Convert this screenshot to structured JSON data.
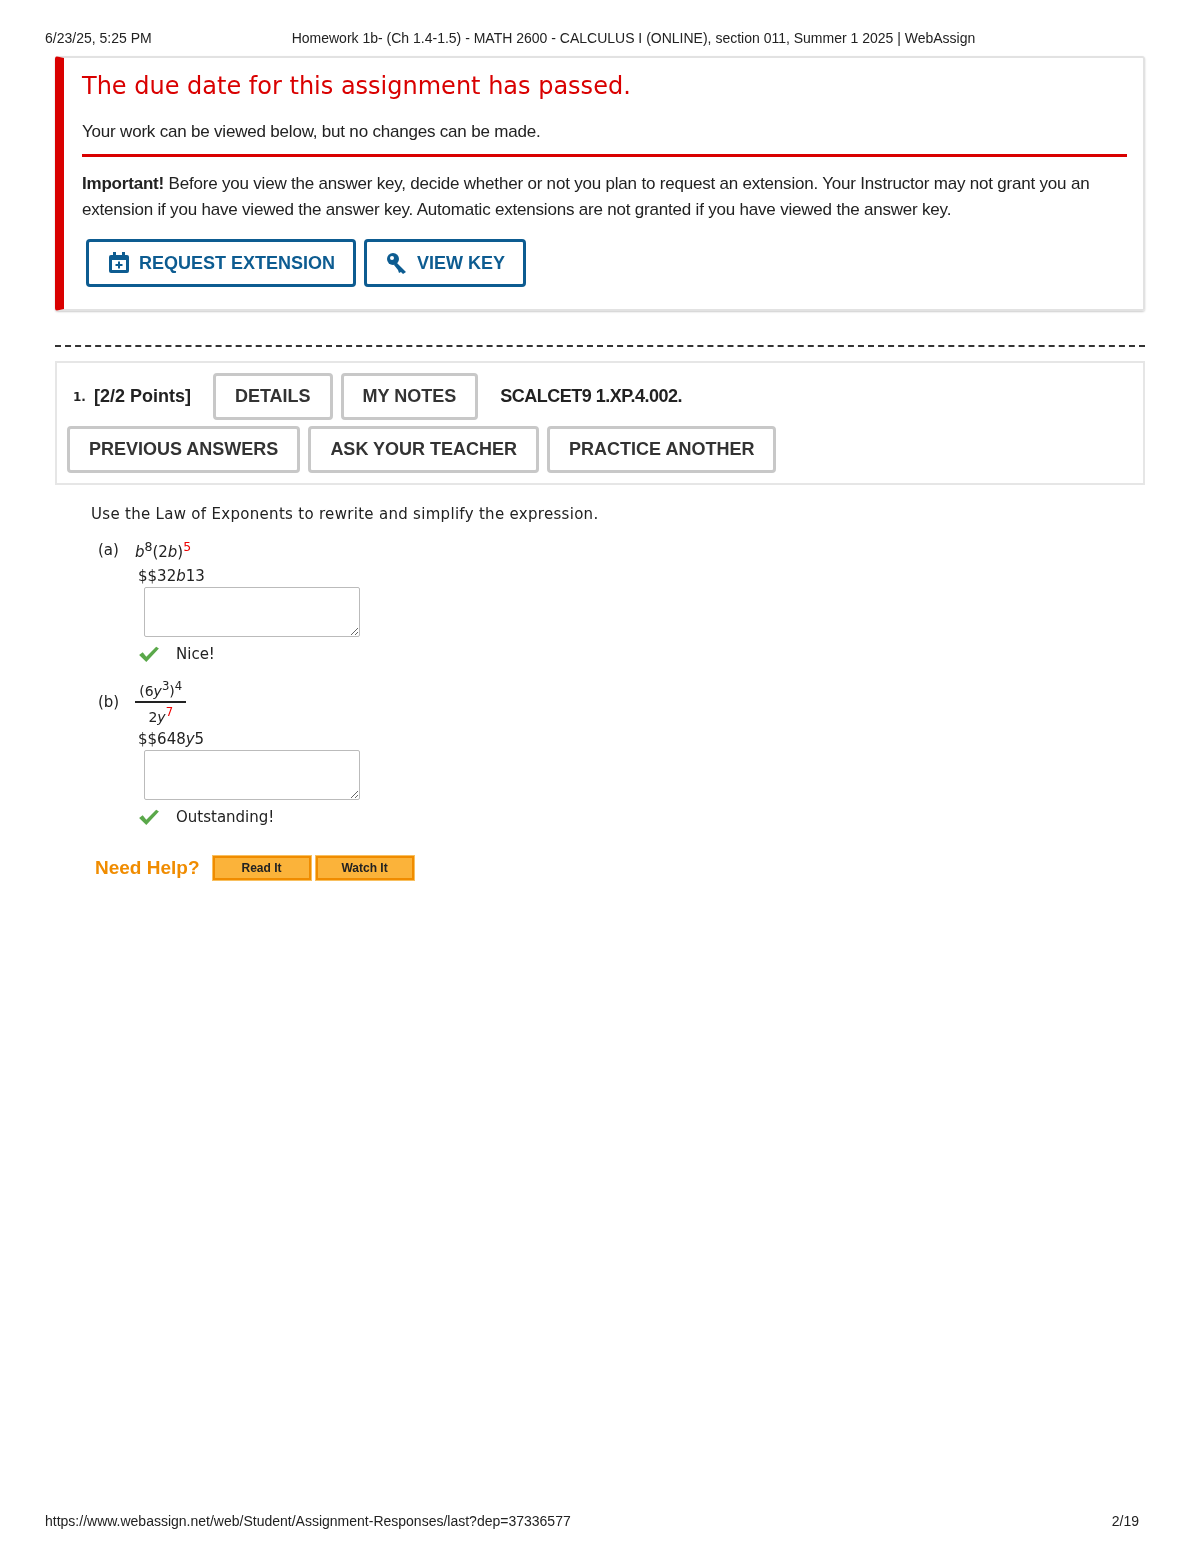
{
  "print_header": {
    "date": "6/23/25, 5:25 PM",
    "title": "Homework 1b- (Ch 1.4-1.5) - MATH 2600 - CALCULUS I (ONLINE), section 011, Summer 1 2025 | WebAssign"
  },
  "notice": {
    "heading": "The due date for this assignment has passed.",
    "message": "Your work can be viewed below, but no changes can be made.",
    "important": "**Important!** Before you view the answer key, decide whether or not you plan to request an extension. Your Instructor may not grant you an extension if you have viewed the answer key. Automatic extensions are not granted if you have viewed the answer key.",
    "buttons": [
      {
        "kind": "calendar",
        "label": "REQUEST EXTENSION"
      },
      {
        "kind": "key",
        "label": "VIEW KEY"
      }
    ]
  },
  "question": {
    "number": "1.",
    "points": "[2/2 Points]",
    "top_buttons": [
      "DETAILS",
      "MY NOTES"
    ],
    "code": "SCALCET9 1.XP.4.002.",
    "buttons": [
      "PREVIOUS ANSWERS",
      "ASK YOUR TEACHER",
      "PRACTICE ANOTHER"
    ],
    "prompt": "Use the Law of Exponents to rewrite and simplify the expression.",
    "parts": [
      {
        "kind": "inline",
        "label": "(a)",
        "expression": [
          {
            "kind": "var",
            "text": "b"
          },
          {
            "kind": "sup",
            "text": "8"
          },
          {
            "kind": "plain",
            "text": "(2"
          },
          {
            "kind": "var",
            "text": "b"
          },
          {
            "kind": "plain",
            "text": ")"
          },
          {
            "kind": "sup_red",
            "text": "5"
          }
        ],
        "answer": [
          {
            "kind": "plain",
            "text": "$$32"
          },
          {
            "kind": "var",
            "text": "b"
          },
          {
            "kind": "plain",
            "text": "13"
          }
        ],
        "correct": true,
        "feedback": "Nice!"
      },
      {
        "kind": "fraction",
        "label": "(b)",
        "numerator": [
          {
            "kind": "plain",
            "text": "(6"
          },
          {
            "kind": "var",
            "text": "y"
          },
          {
            "kind": "sup",
            "text": "3"
          },
          {
            "kind": "plain",
            "text": ")"
          },
          {
            "kind": "sup",
            "text": "4"
          }
        ],
        "denominator": [
          {
            "kind": "plain",
            "text": "2"
          },
          {
            "kind": "var",
            "text": "y"
          },
          {
            "kind": "sup_red",
            "text": "7"
          }
        ],
        "answer": [
          {
            "kind": "plain",
            "text": "$$648"
          },
          {
            "kind": "var",
            "text": "y"
          },
          {
            "kind": "plain",
            "text": "5"
          }
        ],
        "correct": true,
        "feedback": "Outstanding!"
      }
    ],
    "help": {
      "label": "Need Help?",
      "buttons": [
        "Read It",
        "Watch It"
      ]
    }
  },
  "print_footer": {
    "url": "https://www.webassign.net/web/Student/Assignment-Responses/last?dep=37336577",
    "page": "2/19"
  }
}
